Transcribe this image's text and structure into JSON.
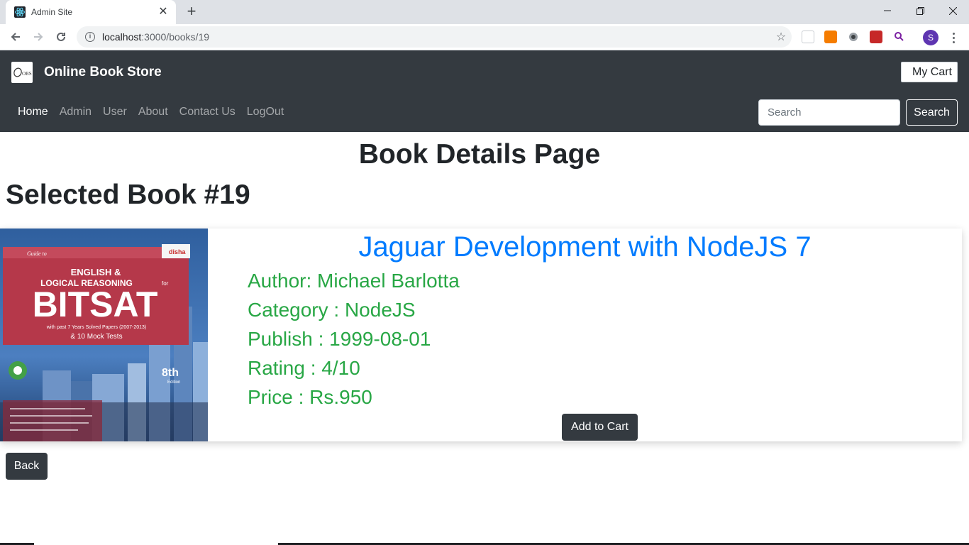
{
  "browser": {
    "tab_title": "Admin Site",
    "url_host": "localhost",
    "url_rest": ":3000/books/19",
    "profile_initial": "S"
  },
  "navbar": {
    "brand": "Online Book Store",
    "logo_text": "OBS",
    "cart_label": "My Cart",
    "links": [
      "Home",
      "Admin",
      "User",
      "About",
      "Contact Us",
      "LogOut"
    ],
    "active_link": "Home",
    "search_placeholder": "Search",
    "search_button": "Search"
  },
  "page": {
    "heading": "Book Details Page",
    "selected": "Selected Book #19"
  },
  "book": {
    "title": "Jaguar Development with NodeJS 7",
    "author": "Author: Michael Barlotta",
    "category": "Category : NodeJS",
    "publish": "Publish : 1999-08-01",
    "rating": "Rating : 4/10",
    "price": "Price : Rs.950",
    "add_to_cart": "Add to Cart",
    "cover": {
      "small_top": "Guide to",
      "line1": "ENGLISH &",
      "line2": "LOGICAL REASONING",
      "line2_suffix": "for",
      "big": "BITSAT",
      "sub1": "with past 7 Years Solved Papers (2007-2013)",
      "sub2": "& 10 Mock Tests",
      "edition": "8th",
      "edition_word": "Edition",
      "publisher": "disha"
    }
  },
  "actions": {
    "back": "Back"
  },
  "colors": {
    "navbar_bg": "#343a40",
    "title_blue": "#007bff",
    "detail_green": "#28a745"
  }
}
